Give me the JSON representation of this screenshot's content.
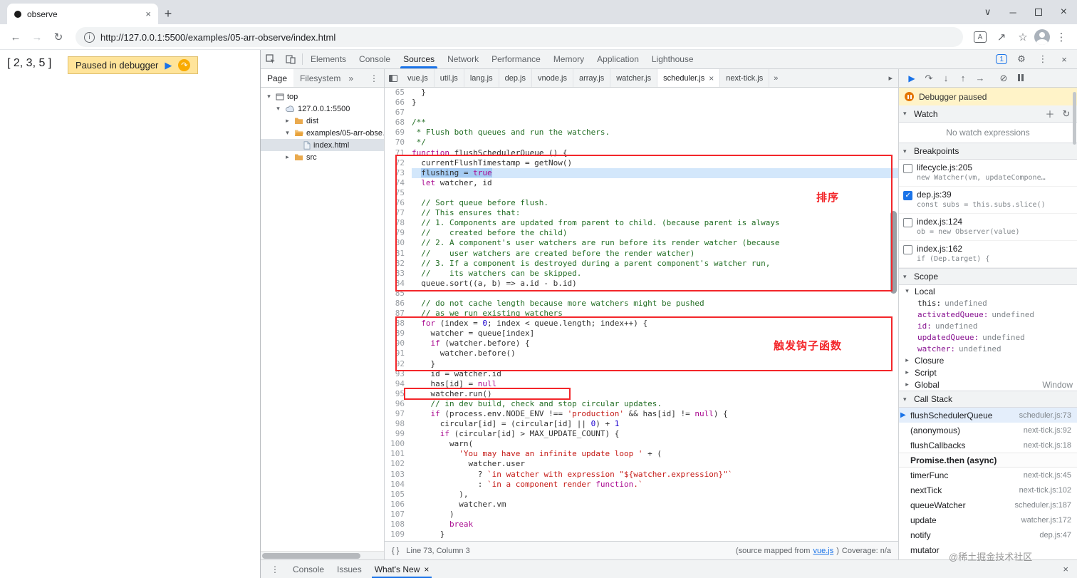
{
  "browser": {
    "tab": {
      "title": "observe"
    },
    "nav": {
      "url": "http://127.0.0.1:5500/examples/05-arr-observe/index.html"
    }
  },
  "page": {
    "array_text": "[ 2, 3, 5 ]",
    "paused_banner": "Paused in debugger"
  },
  "devtools": {
    "main_tabs": [
      "Elements",
      "Console",
      "Sources",
      "Network",
      "Performance",
      "Memory",
      "Application",
      "Lighthouse"
    ],
    "active_main_tab": "Sources",
    "messages_count": "1",
    "navigator": {
      "tabs": [
        {
          "label": "Page",
          "active": true
        },
        {
          "label": "Filesystem",
          "active": false
        }
      ],
      "tree": [
        {
          "label": "top",
          "depth": 0,
          "expand": "open",
          "icon": "frame",
          "selected": false
        },
        {
          "label": "127.0.0.1:5500",
          "depth": 1,
          "expand": "open",
          "icon": "cloud",
          "selected": false
        },
        {
          "label": "dist",
          "depth": 2,
          "expand": "closed",
          "icon": "folder",
          "selected": false
        },
        {
          "label": "examples/05-arr-obse…",
          "depth": 2,
          "expand": "open",
          "icon": "folder-open",
          "selected": false
        },
        {
          "label": "index.html",
          "depth": 3,
          "expand": "none",
          "icon": "file",
          "selected": true
        },
        {
          "label": "src",
          "depth": 2,
          "expand": "closed",
          "icon": "folder",
          "selected": false
        }
      ]
    },
    "file_tabs": [
      {
        "label": "vue.js",
        "active": false,
        "closable": false
      },
      {
        "label": "util.js",
        "active": false,
        "closable": false
      },
      {
        "label": "lang.js",
        "active": false,
        "closable": false
      },
      {
        "label": "dep.js",
        "active": false,
        "closable": false
      },
      {
        "label": "vnode.js",
        "active": false,
        "closable": false
      },
      {
        "label": "array.js",
        "active": false,
        "closable": false
      },
      {
        "label": "watcher.js",
        "active": false,
        "closable": false
      },
      {
        "label": "scheduler.js",
        "active": true,
        "closable": true
      },
      {
        "label": "next-tick.js",
        "active": false,
        "closable": false
      }
    ],
    "editor": {
      "current_line": 73,
      "lines": [
        {
          "n": 65,
          "t": "  }"
        },
        {
          "n": 66,
          "t": "}"
        },
        {
          "n": 67,
          "t": ""
        },
        {
          "n": 68,
          "t": "/**"
        },
        {
          "n": 69,
          "t": " * Flush both queues and run the watchers."
        },
        {
          "n": 70,
          "t": " */"
        },
        {
          "n": 71,
          "t": "function flushSchedulerQueue () {"
        },
        {
          "n": 72,
          "t": "  currentFlushTimestamp = getNow()"
        },
        {
          "n": 73,
          "t": "  flushing = true"
        },
        {
          "n": 74,
          "t": "  let watcher, id"
        },
        {
          "n": 75,
          "t": ""
        },
        {
          "n": 76,
          "t": "  // Sort queue before flush."
        },
        {
          "n": 77,
          "t": "  // This ensures that:"
        },
        {
          "n": 78,
          "t": "  // 1. Components are updated from parent to child. (because parent is always"
        },
        {
          "n": 79,
          "t": "  //    created before the child)"
        },
        {
          "n": 80,
          "t": "  // 2. A component's user watchers are run before its render watcher (because"
        },
        {
          "n": 81,
          "t": "  //    user watchers are created before the render watcher)"
        },
        {
          "n": 82,
          "t": "  // 3. If a component is destroyed during a parent component's watcher run,"
        },
        {
          "n": 83,
          "t": "  //    its watchers can be skipped."
        },
        {
          "n": 84,
          "t": "  queue.sort((a, b) => a.id - b.id)"
        },
        {
          "n": 85,
          "t": ""
        },
        {
          "n": 86,
          "t": "  // do not cache length because more watchers might be pushed"
        },
        {
          "n": 87,
          "t": "  // as we run existing watchers"
        },
        {
          "n": 88,
          "t": "  for (index = 0; index < queue.length; index++) {"
        },
        {
          "n": 89,
          "t": "    watcher = queue[index]"
        },
        {
          "n": 90,
          "t": "    if (watcher.before) {"
        },
        {
          "n": 91,
          "t": "      watcher.before()"
        },
        {
          "n": 92,
          "t": "    }"
        },
        {
          "n": 93,
          "t": "    id = watcher.id"
        },
        {
          "n": 94,
          "t": "    has[id] = null"
        },
        {
          "n": 95,
          "t": "    watcher.run()"
        },
        {
          "n": 96,
          "t": "    // in dev build, check and stop circular updates."
        },
        {
          "n": 97,
          "t": "    if (process.env.NODE_ENV !== 'production' && has[id] != null) {"
        },
        {
          "n": 98,
          "t": "      circular[id] = (circular[id] || 0) + 1"
        },
        {
          "n": 99,
          "t": "      if (circular[id] > MAX_UPDATE_COUNT) {"
        },
        {
          "n": 100,
          "t": "        warn("
        },
        {
          "n": 101,
          "t": "          'You may have an infinite update loop ' + ("
        },
        {
          "n": 102,
          "t": "            watcher.user"
        },
        {
          "n": 103,
          "t": "              ? `in watcher with expression \"${watcher.expression}\"`"
        },
        {
          "n": 104,
          "t": "              : `in a component render function.`"
        },
        {
          "n": 105,
          "t": "          ),"
        },
        {
          "n": 106,
          "t": "          watcher.vm"
        },
        {
          "n": 107,
          "t": "        )"
        },
        {
          "n": 108,
          "t": "        break"
        },
        {
          "n": 109,
          "t": "      }"
        }
      ]
    },
    "annotations": {
      "sort_label": "排序",
      "hooks_label": "触发钩子函数"
    },
    "status_bar": {
      "format_icon": "{ }",
      "line_col": "Line 73, Column 3",
      "mapped_prefix": "(source mapped from ",
      "mapped_link": "vue.js",
      "mapped_suffix": ")",
      "coverage": "Coverage: n/a"
    },
    "debugger": {
      "paused_label": "Debugger paused",
      "watch": {
        "title": "Watch",
        "empty": "No watch expressions"
      },
      "breakpoints_title": "Breakpoints",
      "breakpoints": [
        {
          "loc": "lifecycle.js:205",
          "code": "new Watcher(vm, updateCompone…",
          "checked": false
        },
        {
          "loc": "dep.js:39",
          "code": "const subs = this.subs.slice()",
          "checked": true
        },
        {
          "loc": "index.js:124",
          "code": "ob = new Observer(value)",
          "checked": false
        },
        {
          "loc": "index.js:162",
          "code": "if (Dep.target) {",
          "checked": false
        }
      ],
      "scope_title": "Scope",
      "scope": [
        {
          "name": "Local",
          "expanded": true,
          "value": "",
          "vars": [
            {
              "k": "this",
              "v": "undefined"
            },
            {
              "k": "activatedQueue",
              "v": "undefined"
            },
            {
              "k": "id",
              "v": "undefined"
            },
            {
              "k": "updatedQueue",
              "v": "undefined"
            },
            {
              "k": "watcher",
              "v": "undefined"
            }
          ]
        },
        {
          "name": "Closure",
          "expanded": false,
          "value": "",
          "vars": []
        },
        {
          "name": "Script",
          "expanded": false,
          "value": "",
          "vars": []
        },
        {
          "name": "Global",
          "expanded": false,
          "value": "Window",
          "vars": []
        }
      ],
      "call_stack_title": "Call Stack",
      "call_stack": [
        {
          "fn": "flushSchedulerQueue",
          "loc": "scheduler.js:73",
          "active": true,
          "async": false
        },
        {
          "fn": "(anonymous)",
          "loc": "next-tick.js:92",
          "active": false,
          "async": false
        },
        {
          "fn": "flushCallbacks",
          "loc": "next-tick.js:18",
          "active": false,
          "async": false
        },
        {
          "fn": "Promise.then (async)",
          "loc": "",
          "active": false,
          "async": true
        },
        {
          "fn": "timerFunc",
          "loc": "next-tick.js:45",
          "active": false,
          "async": false
        },
        {
          "fn": "nextTick",
          "loc": "next-tick.js:102",
          "active": false,
          "async": false
        },
        {
          "fn": "queueWatcher",
          "loc": "scheduler.js:187",
          "active": false,
          "async": false
        },
        {
          "fn": "update",
          "loc": "watcher.js:172",
          "active": false,
          "async": false
        },
        {
          "fn": "notify",
          "loc": "dep.js:47",
          "active": false,
          "async": false
        },
        {
          "fn": "mutator",
          "loc": "",
          "active": false,
          "async": false
        }
      ]
    },
    "drawer": {
      "tabs": [
        {
          "label": "Console",
          "active": false,
          "closable": false
        },
        {
          "label": "Issues",
          "active": false,
          "closable": false
        },
        {
          "label": "What's New",
          "active": true,
          "closable": true
        }
      ]
    },
    "watermark": "@稀土掘金技术社区"
  }
}
